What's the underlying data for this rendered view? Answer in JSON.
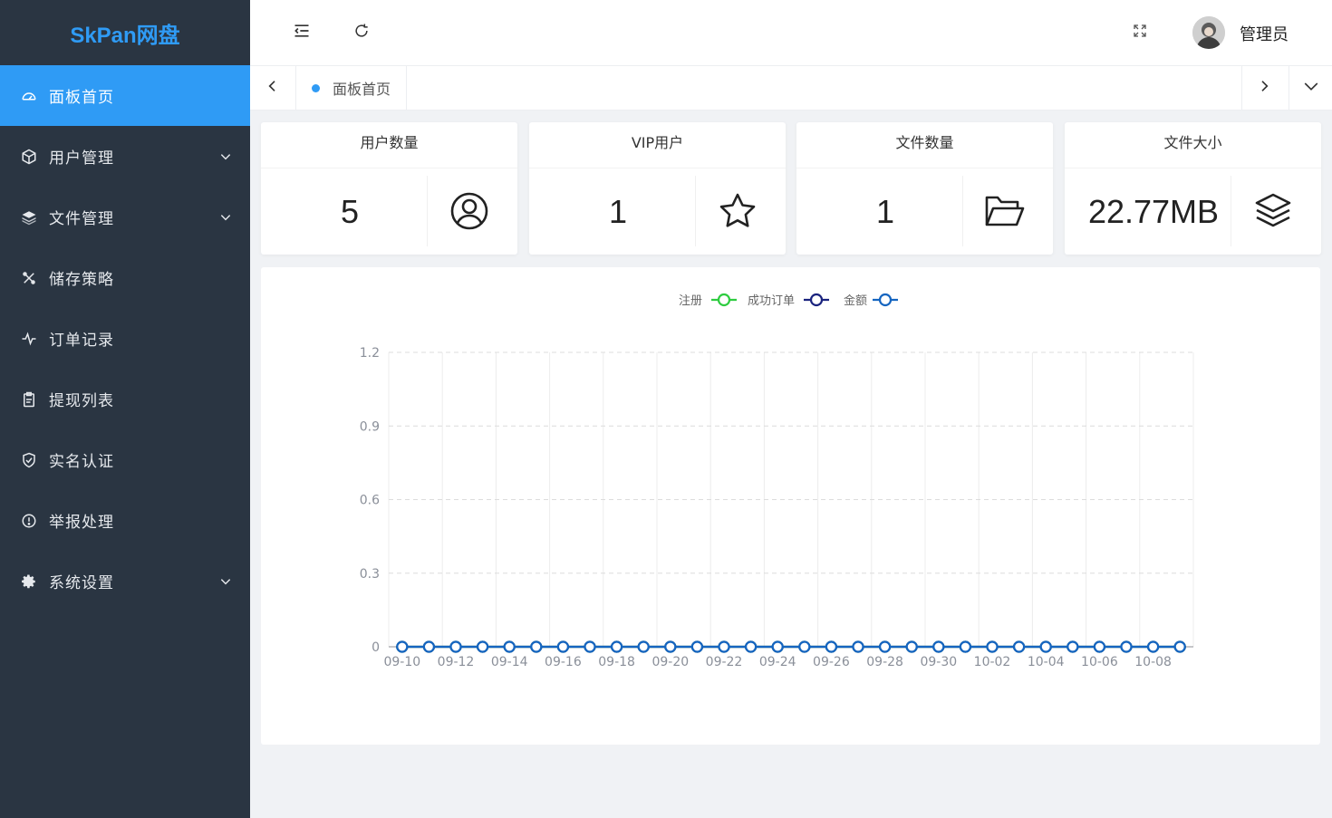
{
  "app": {
    "logo": "SkPan网盘"
  },
  "sidebar": {
    "items": [
      {
        "label": "面板首页",
        "icon": "dashboard-icon",
        "active": true,
        "expandable": false
      },
      {
        "label": "用户管理",
        "icon": "cube-icon",
        "active": false,
        "expandable": true
      },
      {
        "label": "文件管理",
        "icon": "layers-icon",
        "active": false,
        "expandable": true
      },
      {
        "label": "储存策略",
        "icon": "tools-icon",
        "active": false,
        "expandable": false
      },
      {
        "label": "订单记录",
        "icon": "pulse-icon",
        "active": false,
        "expandable": false
      },
      {
        "label": "提现列表",
        "icon": "clipboard-icon",
        "active": false,
        "expandable": false
      },
      {
        "label": "实名认证",
        "icon": "shield-check-icon",
        "active": false,
        "expandable": false
      },
      {
        "label": "举报处理",
        "icon": "info-icon",
        "active": false,
        "expandable": false
      },
      {
        "label": "系统设置",
        "icon": "gear-icon",
        "active": false,
        "expandable": true
      }
    ]
  },
  "header": {
    "username": "管理员"
  },
  "tabs": [
    {
      "label": "面板首页",
      "active": true
    }
  ],
  "stats": [
    {
      "title": "用户数量",
      "value": "5",
      "icon": "user-circle-icon"
    },
    {
      "title": "VIP用户",
      "value": "1",
      "icon": "star-icon"
    },
    {
      "title": "文件数量",
      "value": "1",
      "icon": "folder-open-icon"
    },
    {
      "title": "文件大小",
      "value": "22.77MB",
      "icon": "stack-icon"
    }
  ],
  "colors": {
    "sidebar_bg": "#2a3542",
    "accent": "#2f9bf5",
    "series_register": "#2ecc40",
    "series_orders": "#1a237e",
    "series_amount": "#1565c0"
  },
  "chart_data": {
    "type": "line",
    "title": "",
    "xlabel": "",
    "ylabel": "",
    "ylim": [
      0,
      1.2
    ],
    "yticks": [
      "0",
      "0.3",
      "0.6",
      "0.9",
      "1.2"
    ],
    "grid": true,
    "legend_position": "top-center",
    "x": [
      "09-10",
      "09-11",
      "09-12",
      "09-13",
      "09-14",
      "09-15",
      "09-16",
      "09-17",
      "09-18",
      "09-19",
      "09-20",
      "09-21",
      "09-22",
      "09-23",
      "09-24",
      "09-25",
      "09-26",
      "09-27",
      "09-28",
      "09-29",
      "09-30",
      "10-01",
      "10-02",
      "10-03",
      "10-04",
      "10-05",
      "10-06",
      "10-07",
      "10-08",
      "10-09"
    ],
    "xtick_labels": [
      "09-10",
      "09-12",
      "09-14",
      "09-16",
      "09-18",
      "09-20",
      "09-22",
      "09-24",
      "09-26",
      "09-28",
      "09-30",
      "10-02",
      "10-04",
      "10-06",
      "10-08"
    ],
    "series": [
      {
        "name": "注册",
        "color": "#2ecc40",
        "values": [
          0,
          0,
          0,
          0,
          0,
          0,
          0,
          0,
          0,
          0,
          0,
          0,
          0,
          0,
          0,
          0,
          0,
          0,
          0,
          0,
          0,
          0,
          0,
          0,
          0,
          0,
          0,
          0,
          0,
          0
        ]
      },
      {
        "name": "成功订单",
        "color": "#1a237e",
        "values": [
          0,
          0,
          0,
          0,
          0,
          0,
          0,
          0,
          0,
          0,
          0,
          0,
          0,
          0,
          0,
          0,
          0,
          0,
          0,
          0,
          0,
          0,
          0,
          0,
          0,
          0,
          0,
          0,
          0,
          0
        ]
      },
      {
        "name": "金额",
        "color": "#1565c0",
        "values": [
          0,
          0,
          0,
          0,
          0,
          0,
          0,
          0,
          0,
          0,
          0,
          0,
          0,
          0,
          0,
          0,
          0,
          0,
          0,
          0,
          0,
          0,
          0,
          0,
          0,
          0,
          0,
          0,
          0,
          0
        ]
      }
    ]
  }
}
